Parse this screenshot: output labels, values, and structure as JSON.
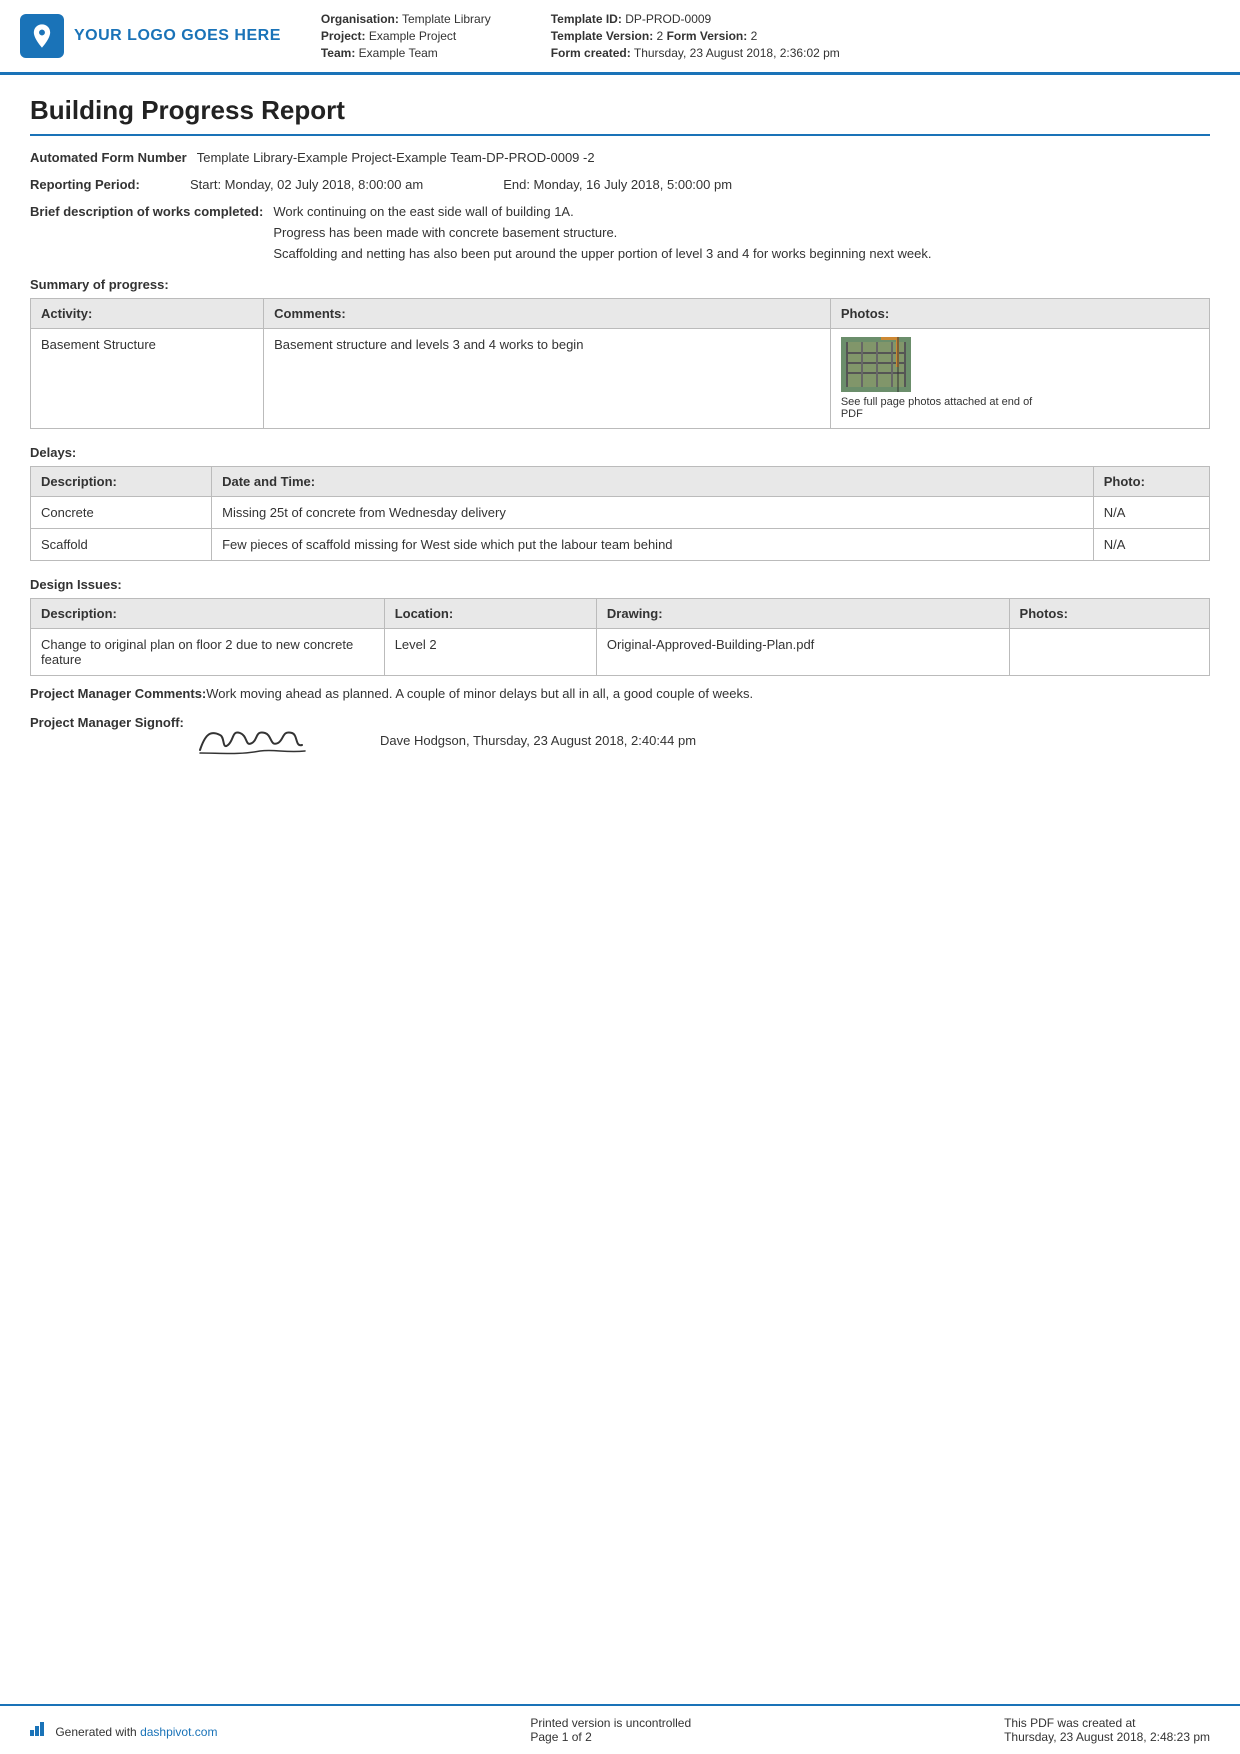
{
  "header": {
    "logo_text": "YOUR LOGO GOES HERE",
    "org_label": "Organisation:",
    "org_value": "Template Library",
    "project_label": "Project:",
    "project_value": "Example Project",
    "team_label": "Team:",
    "team_value": "Example Team",
    "template_id_label": "Template ID:",
    "template_id_value": "DP-PROD-0009",
    "template_version_label": "Template Version:",
    "template_version_value": "2",
    "form_version_label": "Form Version:",
    "form_version_value": "2",
    "form_created_label": "Form created:",
    "form_created_value": "Thursday, 23 August 2018, 2:36:02 pm"
  },
  "report": {
    "title": "Building Progress Report",
    "automated_form_number_label": "Automated Form Number",
    "automated_form_number_value": "Template Library-Example Project-Example Team-DP-PROD-0009   -2",
    "reporting_period_label": "Reporting Period:",
    "reporting_period_start": "Start: Monday, 02 July 2018, 8:00:00 am",
    "reporting_period_end": "End: Monday, 16 July 2018, 5:00:00 pm",
    "brief_desc_label": "Brief description of works completed:",
    "brief_desc_lines": [
      "Work continuing on the east side wall of building 1A.",
      "Progress has been made with concrete basement structure.",
      "Scaffolding and netting has also been put around the upper portion of level 3 and 4 for works beginning next week."
    ]
  },
  "summary": {
    "section_header": "Summary of progress:",
    "table": {
      "columns": [
        "Activity:",
        "Comments:",
        "Photos:"
      ],
      "rows": [
        {
          "activity": "Basement Structure",
          "comments": "Basement structure and levels 3 and 4 works to begin",
          "photo_caption": "See full page photos attached at end of PDF"
        }
      ]
    }
  },
  "delays": {
    "section_header": "Delays:",
    "table": {
      "columns": [
        "Description:",
        "Date and Time:",
        "Photo:"
      ],
      "rows": [
        {
          "description": "Concrete",
          "date_time": "Missing 25t of concrete from Wednesday delivery",
          "photo": "N/A"
        },
        {
          "description": "Scaffold",
          "date_time": "Few pieces of scaffold missing for West side which put the labour team behind",
          "photo": "N/A"
        }
      ]
    }
  },
  "design_issues": {
    "section_header": "Design Issues:",
    "table": {
      "columns": [
        "Description:",
        "Location:",
        "Drawing:",
        "Photos:"
      ],
      "rows": [
        {
          "description": "Change to original plan on floor 2 due to new concrete feature",
          "location": "Level 2",
          "drawing": "Original-Approved-Building-Plan.pdf",
          "photos": ""
        }
      ]
    }
  },
  "project_manager": {
    "comments_label": "Project Manager Comments:",
    "comments_value": "Work moving ahead as planned. A couple of minor delays but all in all, a good couple of weeks.",
    "signoff_label": "Project Manager Signoff:",
    "signoff_name": "Dave Hodgson, Thursday, 23 August 2018, 2:40:44 pm",
    "signature_text": "Camill"
  },
  "footer": {
    "generated_text": "Generated with ",
    "generated_link": "dashpivot.com",
    "printed_text": "Printed version is uncontrolled",
    "page_text": "Page 1 of 2",
    "created_text": "This PDF was created at",
    "created_date": "Thursday, 23 August 2018, 2:48:23 pm"
  }
}
